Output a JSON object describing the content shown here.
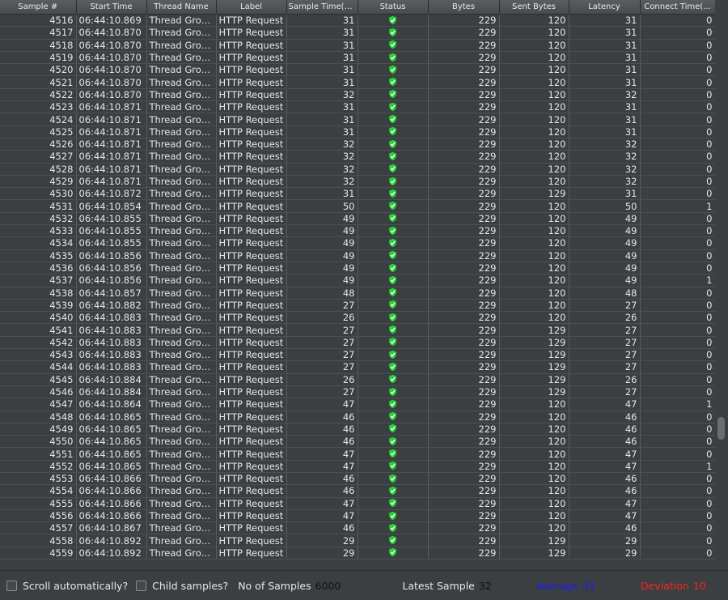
{
  "table": {
    "columns": [
      "Sample #",
      "Start Time",
      "Thread Name",
      "Label",
      "Sample Time(ms)",
      "Status",
      "Bytes",
      "Sent Bytes",
      "Latency",
      "Connect Time(..."
    ],
    "rows": [
      [
        "4516",
        "06:44:10.869",
        "Thread Grou...",
        "HTTP Request",
        "31",
        "ok",
        "229",
        "120",
        "31",
        "0"
      ],
      [
        "4517",
        "06:44:10.870",
        "Thread Grou...",
        "HTTP Request",
        "31",
        "ok",
        "229",
        "120",
        "31",
        "0"
      ],
      [
        "4518",
        "06:44:10.870",
        "Thread Grou...",
        "HTTP Request",
        "31",
        "ok",
        "229",
        "120",
        "31",
        "0"
      ],
      [
        "4519",
        "06:44:10.870",
        "Thread Grou...",
        "HTTP Request",
        "31",
        "ok",
        "229",
        "120",
        "31",
        "0"
      ],
      [
        "4520",
        "06:44:10.870",
        "Thread Grou...",
        "HTTP Request",
        "31",
        "ok",
        "229",
        "120",
        "31",
        "0"
      ],
      [
        "4521",
        "06:44:10.870",
        "Thread Grou...",
        "HTTP Request",
        "31",
        "ok",
        "229",
        "120",
        "31",
        "0"
      ],
      [
        "4522",
        "06:44:10.870",
        "Thread Grou...",
        "HTTP Request",
        "32",
        "ok",
        "229",
        "120",
        "32",
        "0"
      ],
      [
        "4523",
        "06:44:10.871",
        "Thread Grou...",
        "HTTP Request",
        "31",
        "ok",
        "229",
        "120",
        "31",
        "0"
      ],
      [
        "4524",
        "06:44:10.871",
        "Thread Grou...",
        "HTTP Request",
        "31",
        "ok",
        "229",
        "120",
        "31",
        "0"
      ],
      [
        "4525",
        "06:44:10.871",
        "Thread Grou...",
        "HTTP Request",
        "31",
        "ok",
        "229",
        "120",
        "31",
        "0"
      ],
      [
        "4526",
        "06:44:10.871",
        "Thread Grou...",
        "HTTP Request",
        "32",
        "ok",
        "229",
        "120",
        "32",
        "0"
      ],
      [
        "4527",
        "06:44:10.871",
        "Thread Grou...",
        "HTTP Request",
        "32",
        "ok",
        "229",
        "120",
        "32",
        "0"
      ],
      [
        "4528",
        "06:44:10.871",
        "Thread Grou...",
        "HTTP Request",
        "32",
        "ok",
        "229",
        "120",
        "32",
        "0"
      ],
      [
        "4529",
        "06:44:10.871",
        "Thread Grou...",
        "HTTP Request",
        "32",
        "ok",
        "229",
        "120",
        "32",
        "0"
      ],
      [
        "4530",
        "06:44:10.872",
        "Thread Grou...",
        "HTTP Request",
        "31",
        "ok",
        "229",
        "129",
        "31",
        "0"
      ],
      [
        "4531",
        "06:44:10.854",
        "Thread Grou...",
        "HTTP Request",
        "50",
        "ok",
        "229",
        "120",
        "50",
        "1"
      ],
      [
        "4532",
        "06:44:10.855",
        "Thread Grou...",
        "HTTP Request",
        "49",
        "ok",
        "229",
        "120",
        "49",
        "0"
      ],
      [
        "4533",
        "06:44:10.855",
        "Thread Grou...",
        "HTTP Request",
        "49",
        "ok",
        "229",
        "120",
        "49",
        "0"
      ],
      [
        "4534",
        "06:44:10.855",
        "Thread Grou...",
        "HTTP Request",
        "49",
        "ok",
        "229",
        "120",
        "49",
        "0"
      ],
      [
        "4535",
        "06:44:10.856",
        "Thread Grou...",
        "HTTP Request",
        "49",
        "ok",
        "229",
        "120",
        "49",
        "0"
      ],
      [
        "4536",
        "06:44:10.856",
        "Thread Grou...",
        "HTTP Request",
        "49",
        "ok",
        "229",
        "120",
        "49",
        "0"
      ],
      [
        "4537",
        "06:44:10.856",
        "Thread Grou...",
        "HTTP Request",
        "49",
        "ok",
        "229",
        "120",
        "49",
        "1"
      ],
      [
        "4538",
        "06:44:10.857",
        "Thread Grou...",
        "HTTP Request",
        "48",
        "ok",
        "229",
        "120",
        "48",
        "0"
      ],
      [
        "4539",
        "06:44:10.882",
        "Thread Grou...",
        "HTTP Request",
        "27",
        "ok",
        "229",
        "120",
        "27",
        "0"
      ],
      [
        "4540",
        "06:44:10.883",
        "Thread Grou...",
        "HTTP Request",
        "26",
        "ok",
        "229",
        "120",
        "26",
        "0"
      ],
      [
        "4541",
        "06:44:10.883",
        "Thread Grou...",
        "HTTP Request",
        "27",
        "ok",
        "229",
        "129",
        "27",
        "0"
      ],
      [
        "4542",
        "06:44:10.883",
        "Thread Grou...",
        "HTTP Request",
        "27",
        "ok",
        "229",
        "129",
        "27",
        "0"
      ],
      [
        "4543",
        "06:44:10.883",
        "Thread Grou...",
        "HTTP Request",
        "27",
        "ok",
        "229",
        "129",
        "27",
        "0"
      ],
      [
        "4544",
        "06:44:10.883",
        "Thread Grou...",
        "HTTP Request",
        "27",
        "ok",
        "229",
        "129",
        "27",
        "0"
      ],
      [
        "4545",
        "06:44:10.884",
        "Thread Grou...",
        "HTTP Request",
        "26",
        "ok",
        "229",
        "129",
        "26",
        "0"
      ],
      [
        "4546",
        "06:44:10.884",
        "Thread Grou...",
        "HTTP Request",
        "27",
        "ok",
        "229",
        "129",
        "27",
        "0"
      ],
      [
        "4547",
        "06:44:10.864",
        "Thread Grou...",
        "HTTP Request",
        "47",
        "ok",
        "229",
        "120",
        "47",
        "1"
      ],
      [
        "4548",
        "06:44:10.865",
        "Thread Grou...",
        "HTTP Request",
        "46",
        "ok",
        "229",
        "120",
        "46",
        "0"
      ],
      [
        "4549",
        "06:44:10.865",
        "Thread Grou...",
        "HTTP Request",
        "46",
        "ok",
        "229",
        "120",
        "46",
        "0"
      ],
      [
        "4550",
        "06:44:10.865",
        "Thread Grou...",
        "HTTP Request",
        "46",
        "ok",
        "229",
        "120",
        "46",
        "0"
      ],
      [
        "4551",
        "06:44:10.865",
        "Thread Grou...",
        "HTTP Request",
        "47",
        "ok",
        "229",
        "120",
        "47",
        "0"
      ],
      [
        "4552",
        "06:44:10.865",
        "Thread Grou...",
        "HTTP Request",
        "47",
        "ok",
        "229",
        "120",
        "47",
        "1"
      ],
      [
        "4553",
        "06:44:10.866",
        "Thread Grou...",
        "HTTP Request",
        "46",
        "ok",
        "229",
        "120",
        "46",
        "0"
      ],
      [
        "4554",
        "06:44:10.866",
        "Thread Grou...",
        "HTTP Request",
        "46",
        "ok",
        "229",
        "120",
        "46",
        "0"
      ],
      [
        "4555",
        "06:44:10.866",
        "Thread Grou...",
        "HTTP Request",
        "47",
        "ok",
        "229",
        "120",
        "47",
        "0"
      ],
      [
        "4556",
        "06:44:10.866",
        "Thread Grou...",
        "HTTP Request",
        "47",
        "ok",
        "229",
        "120",
        "47",
        "0"
      ],
      [
        "4557",
        "06:44:10.867",
        "Thread Grou...",
        "HTTP Request",
        "46",
        "ok",
        "229",
        "120",
        "46",
        "0"
      ],
      [
        "4558",
        "06:44:10.892",
        "Thread Grou...",
        "HTTP Request",
        "29",
        "ok",
        "229",
        "129",
        "29",
        "0"
      ],
      [
        "4559",
        "06:44:10.892",
        "Thread Grou...",
        "HTTP Request",
        "29",
        "ok",
        "229",
        "129",
        "29",
        "0"
      ]
    ],
    "status_icon": "success-shield-icon",
    "status_color": "#2ecc40"
  },
  "statusbar": {
    "scroll_auto_label": "Scroll automatically?",
    "child_samples_label": "Child samples?",
    "no_samples_label": "No of Samples",
    "no_samples_value": "6000",
    "latest_label": "Latest Sample",
    "latest_value": "32",
    "average_label": "Average",
    "average_value": "31",
    "deviation_label": "Deviation",
    "deviation_value": "10"
  }
}
